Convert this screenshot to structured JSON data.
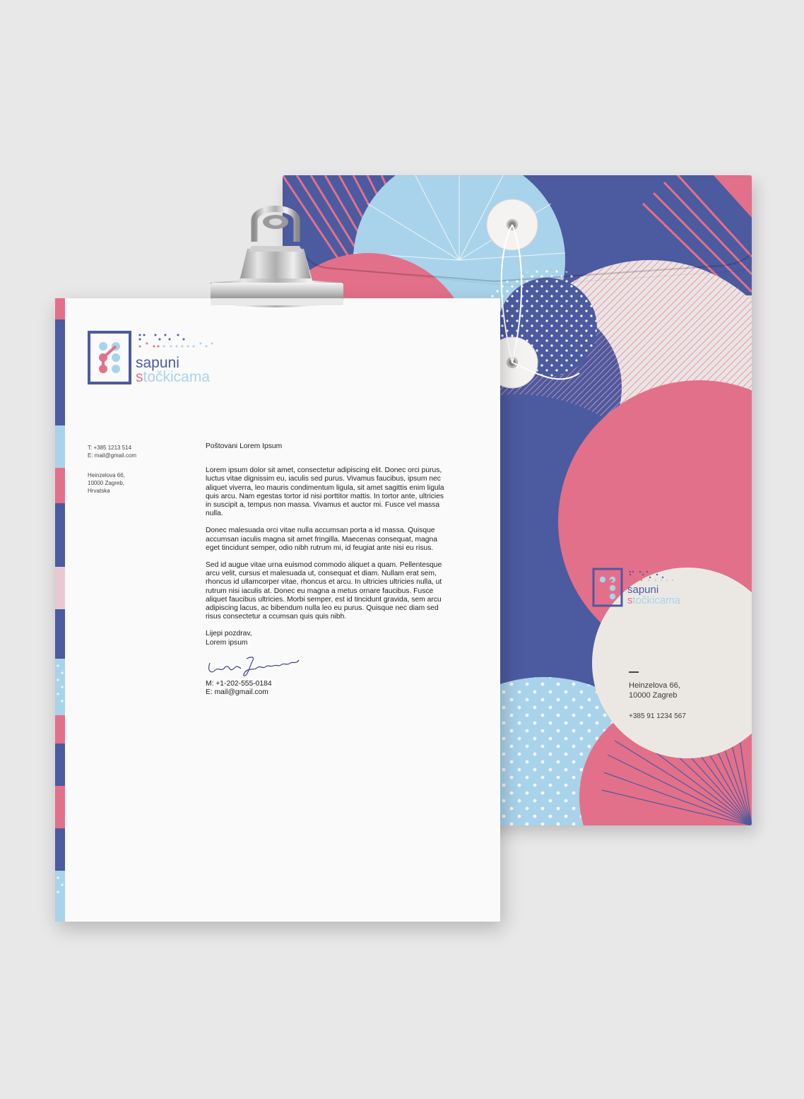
{
  "brand": {
    "name_line1": "sapuni",
    "name_line2": "stočkicama",
    "name_line2_initial": "s",
    "name_line2_rest": "točkicama"
  },
  "letter": {
    "contact": {
      "phone": "T:  +385 1213 514",
      "email": "E:  mail@gmail.com",
      "address_line1": "Heinzelova 66,",
      "address_line2": "10000 Zagreb,",
      "address_line3": "Hrvatska"
    },
    "greeting": "Poštovani Lorem Ipsum",
    "paragraphs": [
      "Lorem ipsum dolor sit amet, consectetur adipiscing elit. Donec orci purus, luctus vitae dignissim eu, iaculis sed purus. Vivamus faucibus, ipsum nec aliquet viverra, leo mauris condimentum ligula, sit amet sagittis enim ligula quis arcu. Nam egestas tortor id nisi porttitor mattis. In tortor ante, ultricies in suscipit a, tempus non massa. Vivamus et auctor mi. Fusce vel massa nulla.",
      "Donec malesuada orci vitae nulla accumsan porta a id massa. Quisque accumsan iaculis magna sit amet fringilla. Maecenas consequat, magna eget tincidunt semper, odio nibh rutrum mi, id feugiat ante nisi eu risus.",
      "Sed id augue vitae urna euismod commodo aliquet a quam. Pellentesque arcu velit, cursus et malesuada ut, consequat et diam. Nullam erat sem, rhoncus id ullamcorper vitae, rhoncus et arcu. In ultricies ultricies nulla, ut rutrum nisi iaculis at. Donec eu magna a metus ornare faucibus. Fusce aliquet faucibus ultricies. Morbi semper, est id tincidunt gravida, sem arcu adipiscing lacus, ac bibendum nulla leo eu purus. Quisque nec diam sed risus consectetur a ccumsan quis quis nibh."
    ],
    "closing_line1": "Lijepi pozdrav,",
    "closing_line2": "Lorem ipsum",
    "signature": "Lorem Ipsum",
    "mobile": "M: +1-202-555-0184",
    "email": "E:  mail@gmail.com"
  },
  "envelope": {
    "address_line1": "Heinzelova 66,",
    "address_line2": "10000 Zagreb",
    "phone": "+385 91 1234 567"
  },
  "colors": {
    "navy": "#4c5aa0",
    "pink": "#e0728a",
    "light_blue": "#a9d3ea",
    "paper": "#fafafa",
    "envelope_gray": "#dedbd7",
    "background": "#e9e8e9"
  }
}
